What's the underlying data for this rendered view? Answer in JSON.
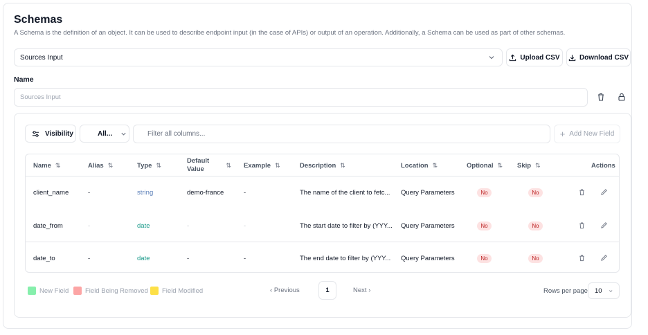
{
  "page": {
    "title": "Schemas",
    "subtitle": "A Schema is the definition of an object. It can be used to describe endpoint input (in the case of APIs) or output of an operation. Additionally, a Schema can be used as part of other schemas."
  },
  "schema_select": {
    "value": "Sources Input",
    "icon": "chevron-down-icon"
  },
  "buttons": {
    "upload_csv": "Upload CSV",
    "download_csv": "Download CSV"
  },
  "name_field": {
    "label": "Name",
    "placeholder": "Sources Input"
  },
  "toolbar": {
    "visibility_label": "Visibility",
    "filter_select_value": "All...",
    "filter_placeholder": "Filter all columns...",
    "add_field_label": "Add New Field"
  },
  "table": {
    "columns": [
      "Name",
      "Alias",
      "Type",
      "Default Value",
      "Example",
      "Description",
      "Location",
      "Optional",
      "Skip",
      "Actions"
    ],
    "rows": [
      {
        "name": "client_name",
        "alias": "-",
        "type": "string",
        "default": "demo-france",
        "example": "-",
        "description": "The name of the client to fetc...",
        "location": "Query Parameters",
        "optional": "No",
        "skip": "No"
      },
      {
        "name": "date_from",
        "alias": "-",
        "type": "date",
        "default": "-",
        "example": "-",
        "description": "The start date to filter by (YYY...",
        "location": "Query Parameters",
        "optional": "No",
        "skip": "No"
      },
      {
        "name": "date_to",
        "alias": "-",
        "type": "date",
        "default": "-",
        "example": "-",
        "description": "The end date to filter by (YYY...",
        "location": "Query Parameters",
        "optional": "No",
        "skip": "No"
      }
    ]
  },
  "legend": [
    {
      "label": "New Field",
      "color": "#86efac"
    },
    {
      "label": "Field Being Removed",
      "color": "#fca5a5"
    },
    {
      "label": "Field Modified",
      "color": "#fde047"
    }
  ],
  "pagination": {
    "previous": "Previous",
    "page": "1",
    "next": "Next",
    "rows_per_page_label": "Rows per page",
    "rows_per_page": "10"
  }
}
